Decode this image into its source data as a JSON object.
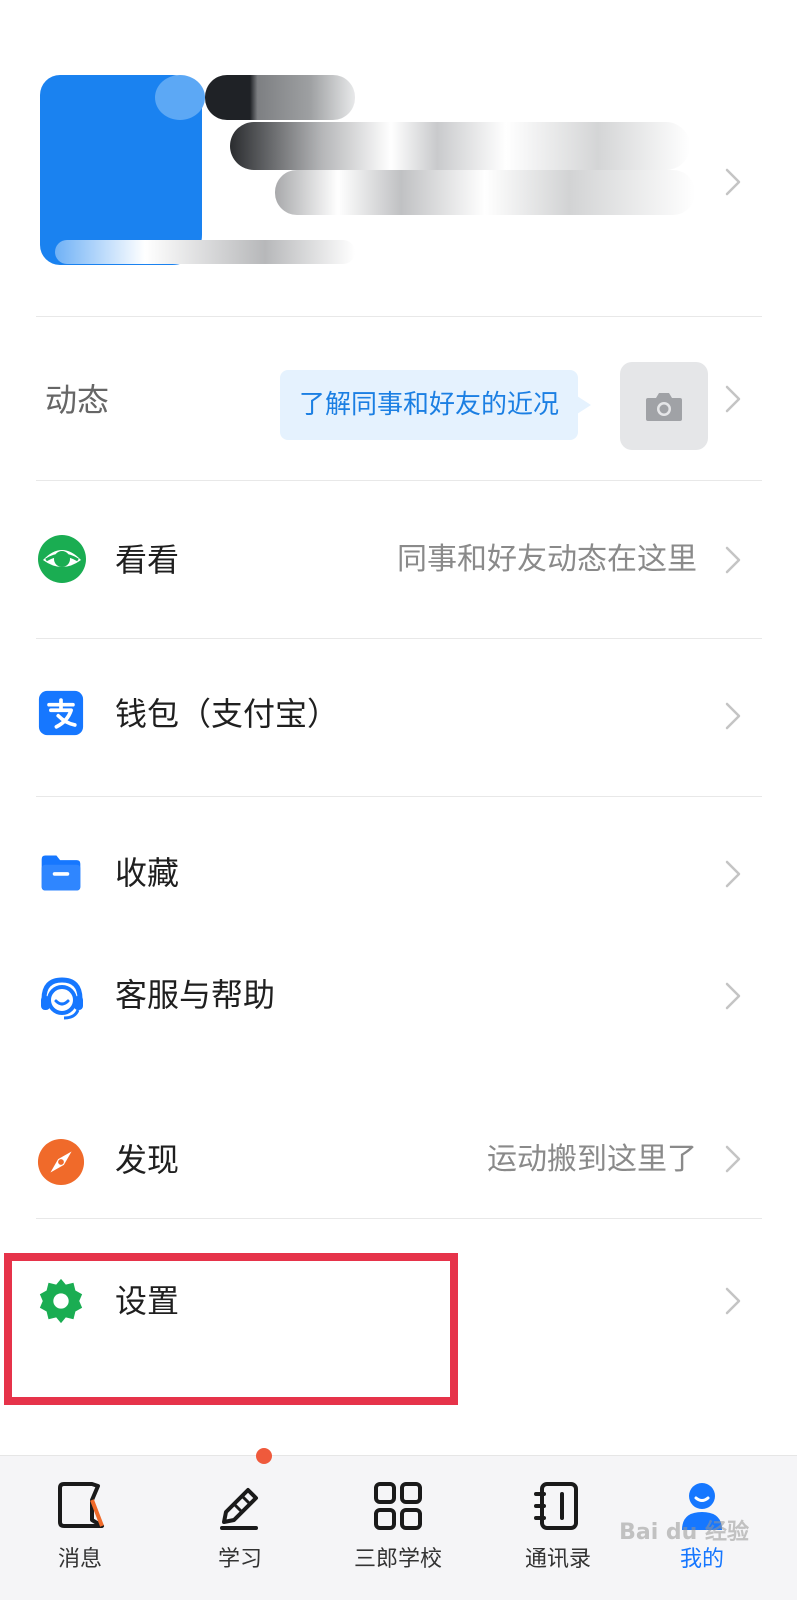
{
  "profile": {
    "name": "",
    "subtitle": ""
  },
  "feed": {
    "label": "动态",
    "bubble": "了解同事和好友的近况",
    "camera_icon": "camera-icon"
  },
  "menu": {
    "kankan": {
      "label": "看看",
      "sub": "同事和好友动态在这里",
      "icon": "eye-icon",
      "color": "#1aad52"
    },
    "wallet": {
      "label": "钱包（支付宝）",
      "sub": "",
      "icon": "alipay-icon",
      "color": "#1677ff"
    },
    "favorites": {
      "label": "收藏",
      "sub": "",
      "icon": "folder-icon",
      "color": "#1677ff"
    },
    "support": {
      "label": "客服与帮助",
      "sub": "",
      "icon": "headset-icon",
      "color": "#1677ff"
    },
    "discover": {
      "label": "发现",
      "sub": "运动搬到这里了",
      "icon": "compass-icon",
      "color": "#f06a2a"
    },
    "settings": {
      "label": "设置",
      "sub": "",
      "icon": "gear-icon",
      "color": "#1aad52"
    }
  },
  "tabs": [
    {
      "label": "消息",
      "icon": "message-icon",
      "active": false
    },
    {
      "label": "学习",
      "icon": "pencil-icon",
      "active": false,
      "badge": true
    },
    {
      "label": "三郎学校",
      "icon": "grid-icon",
      "active": false
    },
    {
      "label": "通讯录",
      "icon": "contacts-icon",
      "active": false
    },
    {
      "label": "我的",
      "icon": "person-icon",
      "active": true
    }
  ],
  "watermark": "Bai du 经验",
  "colors": {
    "accent": "#1677ff",
    "highlight": "#e6334a",
    "bubble_bg": "#e5f2fe",
    "bubble_text": "#1b7fe3"
  }
}
